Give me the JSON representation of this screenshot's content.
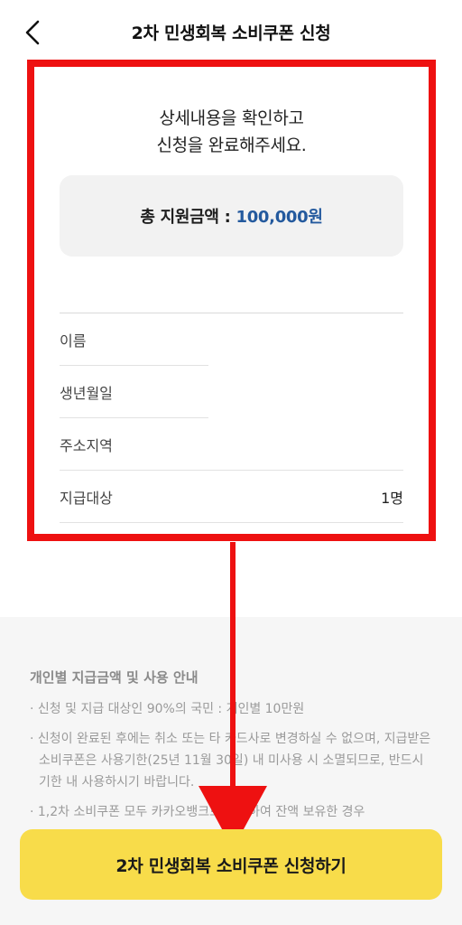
{
  "header": {
    "title": "2차 민생회복 소비쿠폰 신청",
    "back_icon": "chevron-left-icon"
  },
  "summary": {
    "intro_line1": "상세내용을 확인하고",
    "intro_line2": "신청을 완료해주세요.",
    "amount_label": "총 지원금액 :",
    "amount_value": "100,000원"
  },
  "details": {
    "rows": [
      {
        "label": "이름",
        "value": ""
      },
      {
        "label": "생년월일",
        "value": ""
      },
      {
        "label": "주소지역",
        "value": ""
      },
      {
        "label": "지급대상",
        "value": "1명"
      }
    ]
  },
  "info": {
    "title": "개인별 지급금액 및 사용 안내",
    "items": [
      "· 신청 및 지급 대상인 90%의 국민 : 개인별 10만원",
      "· 신청이 완료된 후에는 취소 또는 타 카드사로 변경하실 수 없으며, 지급받은 소비쿠폰은 사용기한(25년 11월 30일) 내 미사용 시 소멸되므로, 반드시 기한 내 사용하시기 바랍니다.",
      "· 1,2차 소비쿠폰 모두 카카오뱅크로 신청하여 잔액 보유한 경우"
    ]
  },
  "cta": {
    "label": "2차 민생회복 소비쿠폰 신청하기"
  },
  "colors": {
    "highlight": "#ee1111",
    "accent_amount": "#245a9e",
    "cta_bg": "#f8dc4a"
  }
}
